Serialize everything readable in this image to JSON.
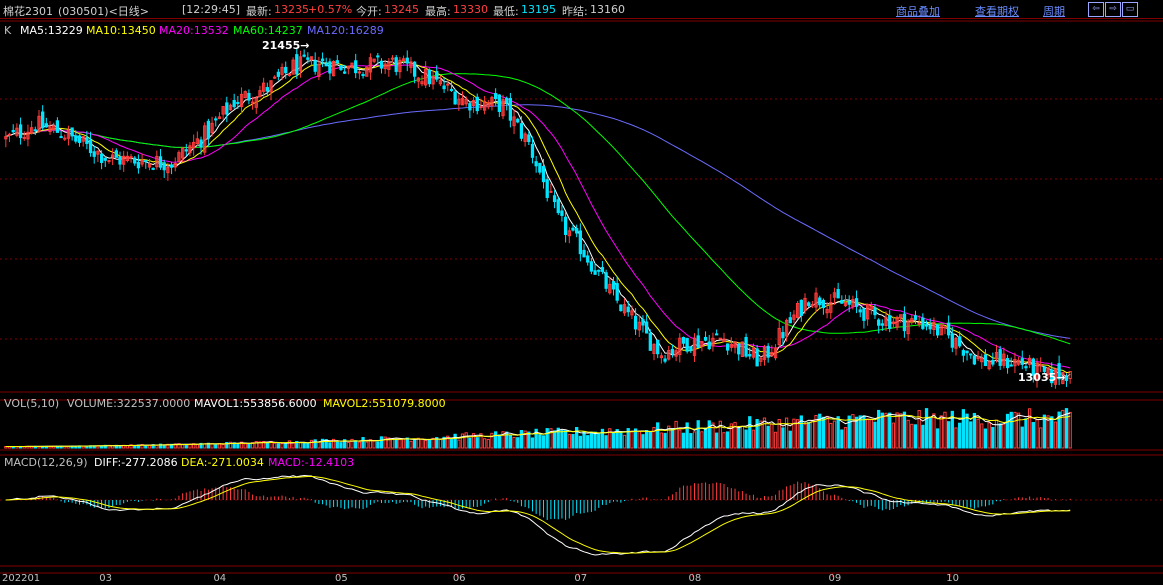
{
  "header": {
    "instrument": "棉花2301",
    "code_period": "(030501)<日线>",
    "time": "[12:29:45]",
    "latest_label": "最新:",
    "latest_value": "13235",
    "change_pct": "+0.57%",
    "open_label": "今开:",
    "open_value": "13245",
    "high_label": "最高:",
    "high_value": "13330",
    "low_label": "最低:",
    "low_value": "13195",
    "prev_close_label": "昨结:",
    "prev_close_value": "13160",
    "links": [
      "商品叠加",
      "查看期权",
      "周期"
    ],
    "nav_buttons": [
      "⇦",
      "⇨",
      "▭"
    ]
  },
  "colors": {
    "up": "#ff3b3b",
    "down": "#00e5ff",
    "ma5": "#ffffff",
    "ma10": "#ffff00",
    "ma20": "#ff00ff",
    "ma60": "#00ff00",
    "ma120": "#6b6bff",
    "grid": "#800000",
    "axis_text": "#c0c0c0"
  },
  "price_panel": {
    "label_k": "K",
    "legend": [
      {
        "text": "MA5:13229",
        "color": "#ffffff"
      },
      {
        "text": "MA10:13450",
        "color": "#ffff00"
      },
      {
        "text": "MA20:13532",
        "color": "#ff00ff"
      },
      {
        "text": "MA60:14237",
        "color": "#00ff00"
      },
      {
        "text": "MA120:16289",
        "color": "#6b6bff"
      }
    ],
    "max_annotation": "21455→",
    "min_annotation": "13035→"
  },
  "volume_panel": {
    "legend": [
      {
        "text": "VOL(5,10)",
        "color": "#c0c0c0"
      },
      {
        "text": "VOLUME:322537.0000",
        "color": "#c0c0c0"
      },
      {
        "text": "MAVOL1:553856.6000",
        "color": "#ffffff"
      },
      {
        "text": "MAVOL2:551079.8000",
        "color": "#ffff00"
      }
    ]
  },
  "macd_panel": {
    "legend": [
      {
        "text": "MACD(12,26,9)",
        "color": "#c0c0c0"
      },
      {
        "text": "DIFF:-277.2086",
        "color": "#ffffff"
      },
      {
        "text": "DEA:-271.0034",
        "color": "#ffff00"
      },
      {
        "text": "MACD:-12.4103",
        "color": "#ff00ff"
      }
    ]
  },
  "x_axis": {
    "labels": [
      "202201",
      "03",
      "04",
      "05",
      "06",
      "07",
      "08",
      "09",
      "10"
    ],
    "label_index": [
      0,
      27,
      58,
      91,
      123,
      156,
      187,
      225,
      257
    ]
  },
  "chart_data": {
    "type": "candlestick",
    "x_start": "2022-01",
    "bars": 290,
    "price_range": [
      12700,
      22400
    ],
    "price_keypoints": [
      [
        0,
        19300
      ],
      [
        8,
        19700
      ],
      [
        15,
        19500
      ],
      [
        28,
        18800
      ],
      [
        45,
        18700
      ],
      [
        55,
        19500
      ],
      [
        62,
        20300
      ],
      [
        72,
        20700
      ],
      [
        78,
        21200
      ],
      [
        86,
        21300
      ],
      [
        95,
        21200
      ],
      [
        105,
        21300
      ],
      [
        115,
        20900
      ],
      [
        125,
        20300
      ],
      [
        135,
        20200
      ],
      [
        142,
        19200
      ],
      [
        150,
        17200
      ],
      [
        156,
        16500
      ],
      [
        165,
        15200
      ],
      [
        170,
        14600
      ],
      [
        178,
        13700
      ],
      [
        185,
        14000
      ],
      [
        195,
        14100
      ],
      [
        205,
        13500
      ],
      [
        212,
        14400
      ],
      [
        218,
        15200
      ],
      [
        228,
        15000
      ],
      [
        238,
        14600
      ],
      [
        250,
        14500
      ],
      [
        258,
        14000
      ],
      [
        265,
        13500
      ],
      [
        275,
        13500
      ],
      [
        283,
        13100
      ],
      [
        289,
        13235
      ]
    ],
    "max_price": 21455,
    "min_price": 13035,
    "last_close": 13235,
    "ma_last": {
      "ma5": 13229,
      "ma10": 13450,
      "ma20": 13532,
      "ma60": 14237,
      "ma120": 16289
    },
    "volume_last": {
      "volume": 322537,
      "mavol1": 553856.6,
      "mavol2": 551079.8
    },
    "macd_last": {
      "diff": -277.2086,
      "dea": -271.0034,
      "macd": -12.4103
    }
  }
}
